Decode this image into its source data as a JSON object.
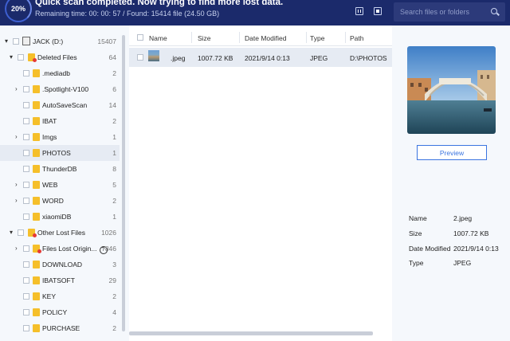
{
  "header": {
    "progress_percent": "20%",
    "title": "Quick scan completed. Now trying to find more lost data.",
    "subtitle": "Remaining time: 00: 00: 57 / Found: 15414 file (24.50 GB)",
    "search_placeholder": "Search files or folders"
  },
  "tree": {
    "items": [
      {
        "label": "JACK (D:)",
        "count": "15407"
      },
      {
        "label": "Deleted Files",
        "count": "64"
      },
      {
        "label": ".mediadb",
        "count": "2"
      },
      {
        "label": ".Spotlight-V100",
        "count": "6"
      },
      {
        "label": "AutoSaveScan",
        "count": "14"
      },
      {
        "label": "IBAT",
        "count": "2"
      },
      {
        "label": "Imgs",
        "count": "1"
      },
      {
        "label": "PHOTOS",
        "count": "1"
      },
      {
        "label": "ThunderDB",
        "count": "8"
      },
      {
        "label": "WEB",
        "count": "5"
      },
      {
        "label": "WORD",
        "count": "2"
      },
      {
        "label": "xiaomiDB",
        "count": "1"
      },
      {
        "label": "Other Lost Files",
        "count": "1026"
      },
      {
        "label": "Files Lost Origin...",
        "count": "846"
      },
      {
        "label": "DOWNLOAD",
        "count": "3"
      },
      {
        "label": "IBATSOFT",
        "count": "29"
      },
      {
        "label": "KEY",
        "count": "2"
      },
      {
        "label": "POLICY",
        "count": "4"
      },
      {
        "label": "PURCHASE",
        "count": "2"
      }
    ]
  },
  "file_list": {
    "columns": [
      "Name",
      "Size",
      "Date Modified",
      "Type",
      "Path"
    ],
    "rows": [
      {
        "name": ".jpeg",
        "size": "1007.72 KB",
        "date": "2021/9/14 0:13",
        "type": "JPEG",
        "path": "D:\\PHOTOS"
      }
    ]
  },
  "preview": {
    "button_label": "Preview",
    "meta": [
      {
        "key": "Name",
        "value": "2.jpeg"
      },
      {
        "key": "Size",
        "value": "1007.72 KB"
      },
      {
        "key": "Date Modified",
        "value": "2021/9/14 0:13"
      },
      {
        "key": "Type",
        "value": "JPEG"
      }
    ]
  }
}
